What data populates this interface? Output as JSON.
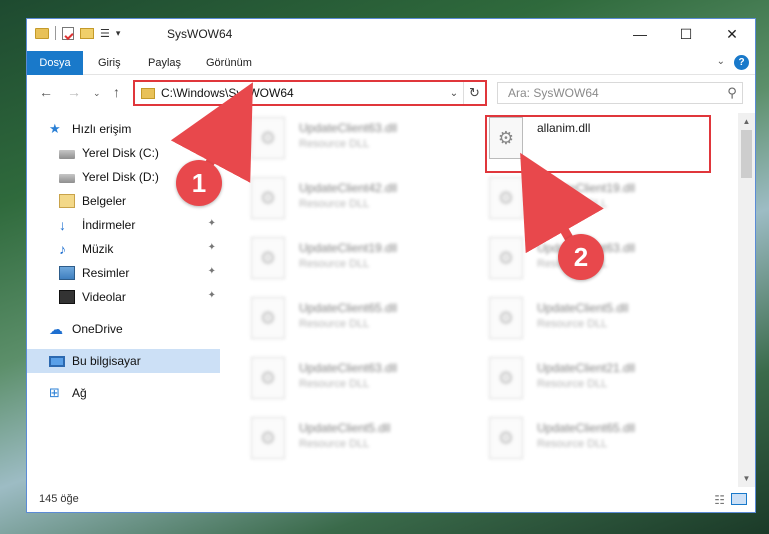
{
  "window": {
    "title": "SysWOW64",
    "controls": {
      "minimize": "—",
      "maximize": "☐",
      "close": "✕"
    }
  },
  "ribbon": {
    "tabs": [
      {
        "label": "Dosya",
        "active": true
      },
      {
        "label": "Giriş"
      },
      {
        "label": "Paylaş"
      },
      {
        "label": "Görünüm"
      }
    ]
  },
  "address_bar": {
    "path": "C:\\Windows\\SysWOW64"
  },
  "search": {
    "placeholder": "Ara: SysWOW64"
  },
  "sidebar": {
    "items": [
      {
        "label": "Hızlı erişim",
        "icon": "star-icon"
      },
      {
        "label": "Yerel Disk (C:)",
        "icon": "drive-icon"
      },
      {
        "label": "Yerel Disk (D:)",
        "icon": "drive-icon"
      },
      {
        "label": "Belgeler",
        "icon": "documents-icon"
      },
      {
        "label": "İndirmeler",
        "icon": "downloads-icon"
      },
      {
        "label": "Müzik",
        "icon": "music-icon"
      },
      {
        "label": "Resimler",
        "icon": "pictures-icon"
      },
      {
        "label": "Videolar",
        "icon": "videos-icon"
      },
      {
        "label": "OneDrive",
        "icon": "cloud-icon"
      },
      {
        "label": "Bu bilgisayar",
        "icon": "computer-icon",
        "selected": true
      },
      {
        "label": "Ağ",
        "icon": "network-icon"
      }
    ]
  },
  "files": [
    {
      "name": "UpdateClient63.dll",
      "type": "Resource DLL",
      "blurred": true
    },
    {
      "name": "allanim.dll",
      "type": "",
      "blurred": false,
      "highlighted": true
    },
    {
      "name": "UpdateClient42.dll",
      "type": "Resource DLL",
      "blurred": true
    },
    {
      "name": "UpdateClient19.dll",
      "type": "Resource DLL",
      "blurred": true
    },
    {
      "name": "UpdateClient19.dll",
      "type": "Resource DLL",
      "blurred": true
    },
    {
      "name": "UpdateClient63.dll",
      "type": "Resource DLL",
      "blurred": true
    },
    {
      "name": "UpdateClient65.dll",
      "type": "Resource DLL",
      "blurred": true
    },
    {
      "name": "UpdateClient5.dll",
      "type": "Resource DLL",
      "blurred": true
    },
    {
      "name": "UpdateClient63.dll",
      "type": "Resource DLL",
      "blurred": true
    },
    {
      "name": "UpdateClient21.dll",
      "type": "Resource DLL",
      "blurred": true
    },
    {
      "name": "UpdateClient5.dll",
      "type": "Resource DLL",
      "blurred": true
    },
    {
      "name": "UpdateClient65.dll",
      "type": "Resource DLL",
      "blurred": true
    }
  ],
  "status": {
    "item_count": "145 öğe"
  },
  "callouts": [
    {
      "number": "1"
    },
    {
      "number": "2"
    }
  ],
  "colors": {
    "accent": "#1979ca",
    "highlight": "#e0363b",
    "callout": "#e8484c"
  }
}
